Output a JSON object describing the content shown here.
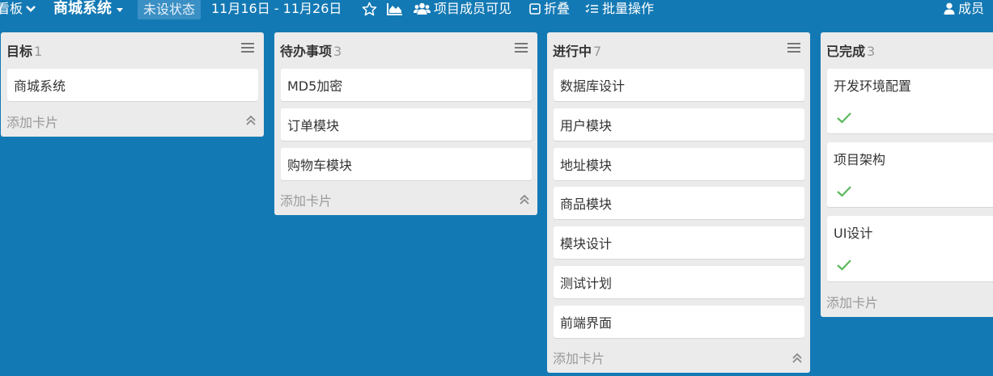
{
  "topbar": {
    "board_menu_label": "看板",
    "board_title": "商城系统",
    "status": "未设状态",
    "date_range": "11月16日 - 11月26日",
    "visibility_label": "项目成员可见",
    "fold_label": "折叠",
    "batch_label": "批量操作",
    "members_label": "成员"
  },
  "lists": [
    {
      "title": "目标",
      "count": "1",
      "cards": [
        {
          "title": "商城系统"
        }
      ],
      "add_card": "添加卡片"
    },
    {
      "title": "待办事项",
      "count": "3",
      "cards": [
        {
          "title": "MD5加密"
        },
        {
          "title": "订单模块"
        },
        {
          "title": "购物车模块"
        }
      ],
      "add_card": "添加卡片"
    },
    {
      "title": "进行中",
      "count": "7",
      "cards": [
        {
          "title": "数据库设计"
        },
        {
          "title": "用户模块"
        },
        {
          "title": "地址模块"
        },
        {
          "title": "商品模块"
        },
        {
          "title": "模块设计"
        },
        {
          "title": "测试计划"
        },
        {
          "title": "前端界面"
        }
      ],
      "add_card": "添加卡片"
    },
    {
      "title": "已完成",
      "count": "3",
      "cards": [
        {
          "title": "开发环境配置",
          "done": true
        },
        {
          "title": "项目架构",
          "done": true
        },
        {
          "title": "UI设计",
          "done": true
        }
      ],
      "add_card": "添加卡片"
    }
  ],
  "icons": {
    "star": "star-icon",
    "chart": "area-chart-icon",
    "visibility": "users-icon",
    "fold": "fold-icon",
    "batch": "batch-list-icon",
    "members": "user-icon",
    "list_menu": "hamburger-icon",
    "collapse": "double-chevron-up-icon",
    "done": "checkmark-icon"
  },
  "colors": {
    "background": "#1379b4",
    "list_bg": "#ebebeb",
    "check": "#5cb85c"
  }
}
